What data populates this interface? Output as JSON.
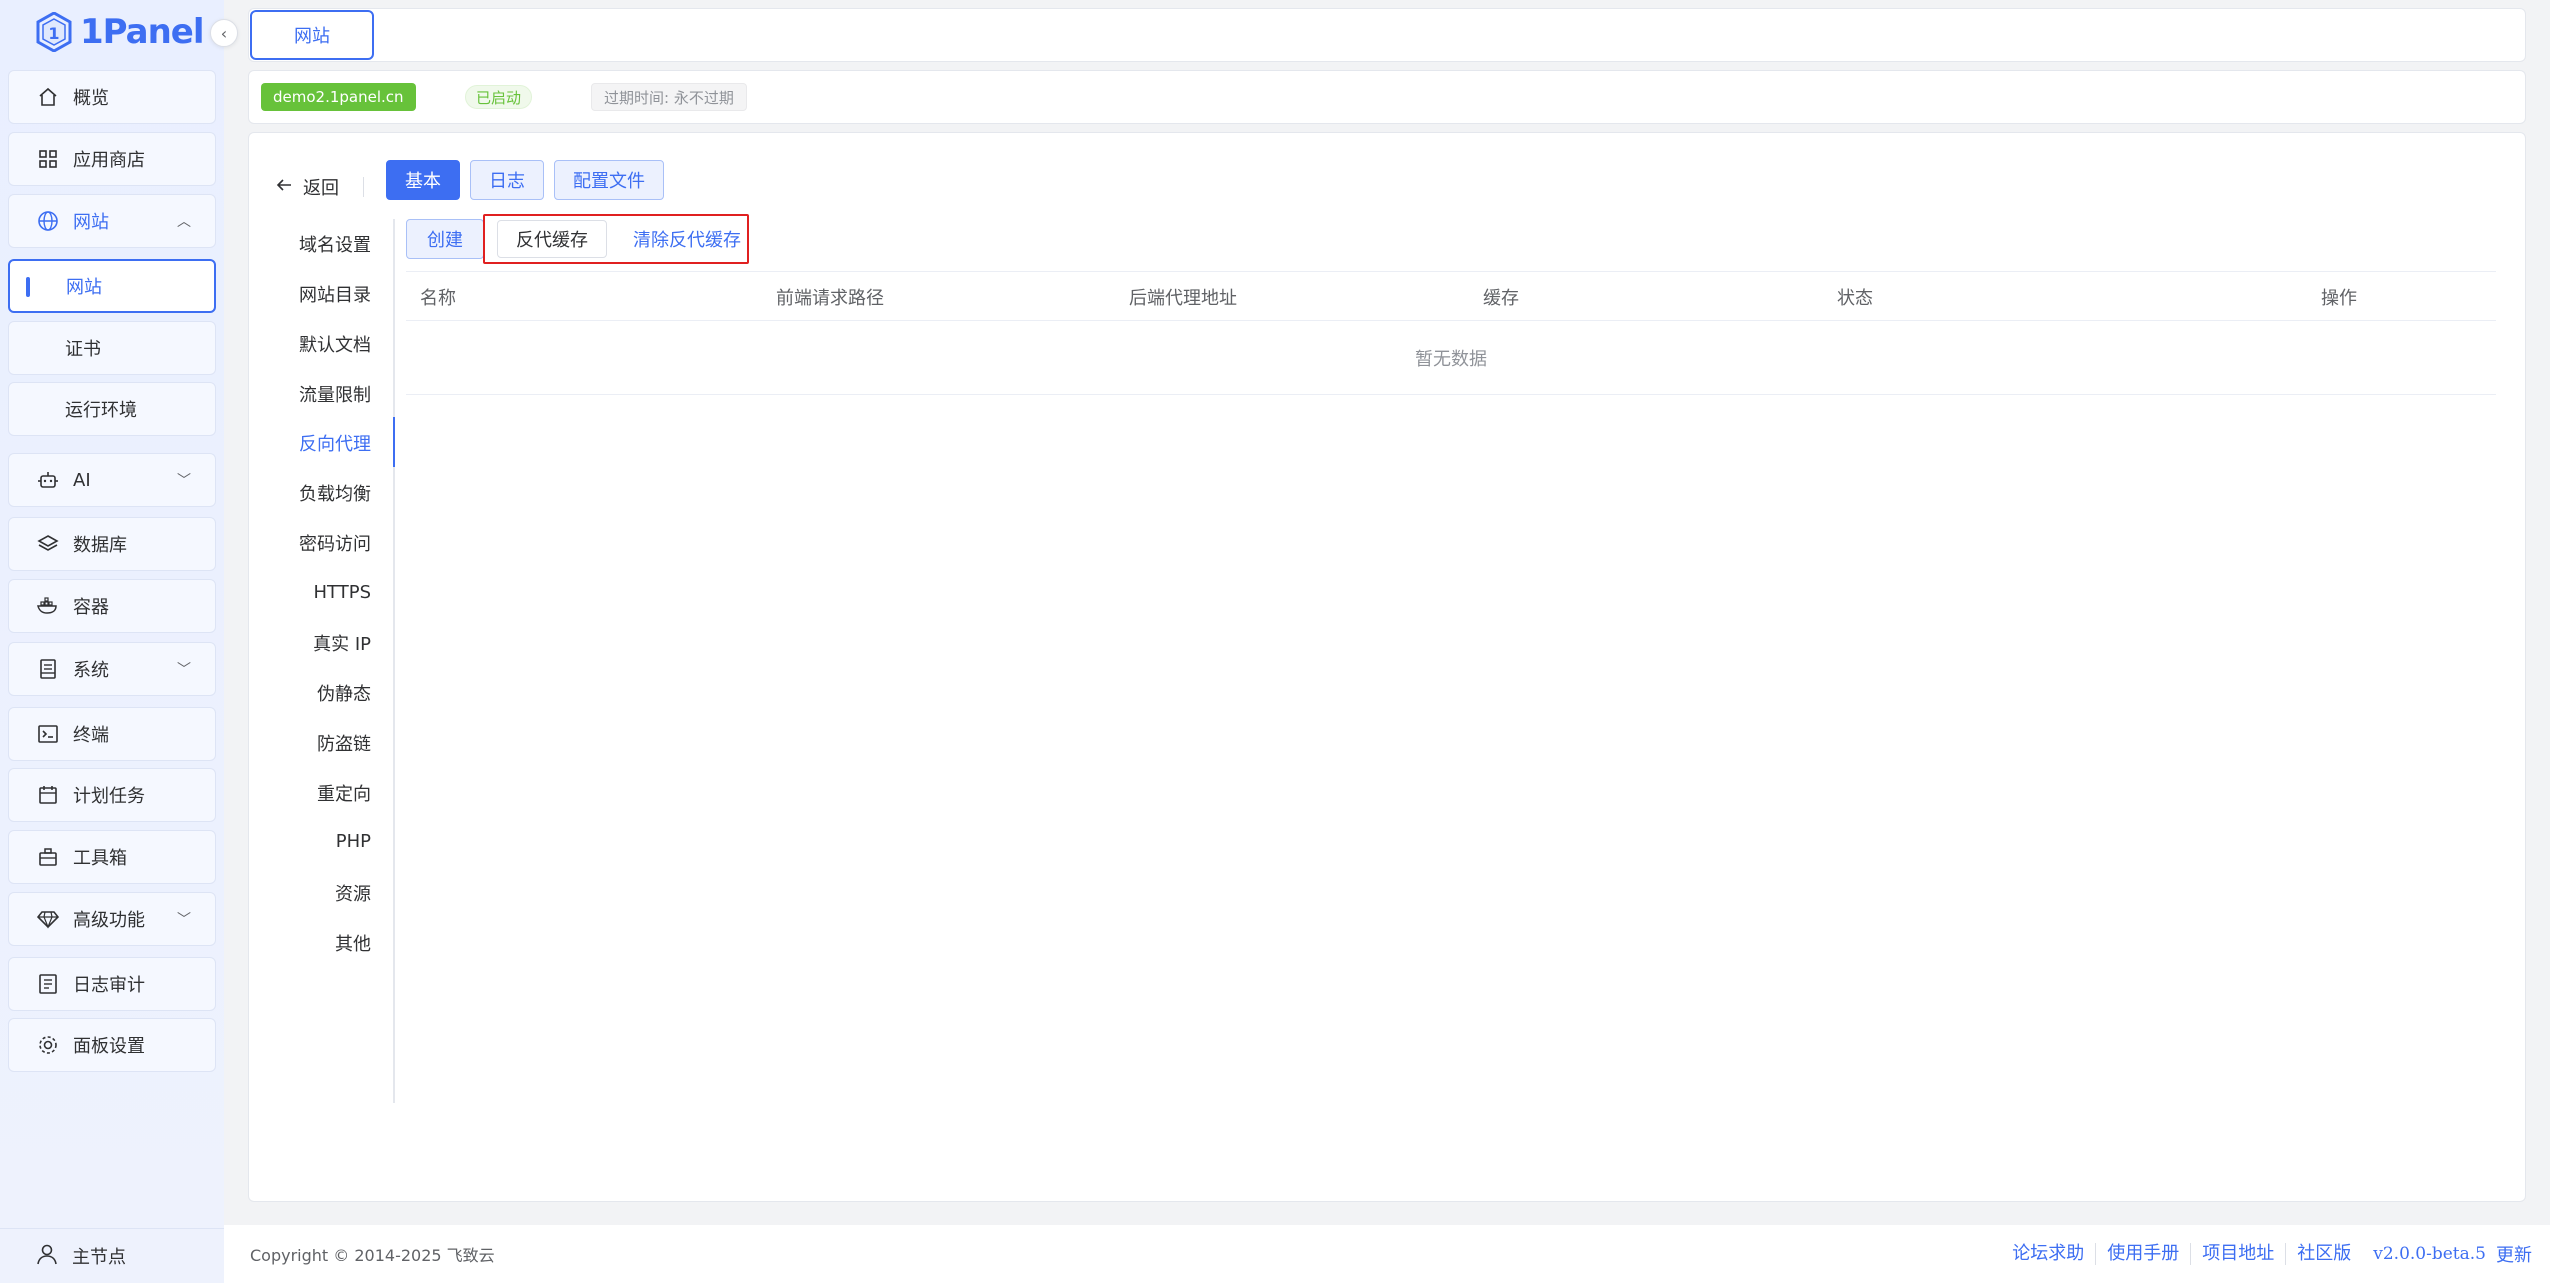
{
  "brand": {
    "name": "1Panel",
    "color": "#3d6ef2"
  },
  "sidebar": {
    "items": [
      {
        "label": "概览",
        "icon": "home-icon"
      },
      {
        "label": "应用商店",
        "icon": "grid-icon"
      },
      {
        "label": "网站",
        "icon": "globe-icon",
        "expanded": true
      },
      {
        "label": "网站",
        "sub": true,
        "active": true
      },
      {
        "label": "证书",
        "sub": true
      },
      {
        "label": "运行环境",
        "sub": true
      },
      {
        "label": "AI",
        "icon": "robot-icon"
      },
      {
        "label": "数据库",
        "icon": "layers-icon"
      },
      {
        "label": "容器",
        "icon": "docker-icon"
      },
      {
        "label": "系统",
        "icon": "server-icon"
      },
      {
        "label": "终端",
        "icon": "terminal-icon"
      },
      {
        "label": "计划任务",
        "icon": "calendar-icon"
      },
      {
        "label": "工具箱",
        "icon": "toolbox-icon"
      },
      {
        "label": "高级功能",
        "icon": "diamond-icon"
      },
      {
        "label": "日志审计",
        "icon": "log-icon"
      },
      {
        "label": "面板设置",
        "icon": "gear-icon"
      }
    ],
    "node": "主节点"
  },
  "tabs": {
    "active": "网站"
  },
  "site": {
    "domain": "demo2.1panel.cn",
    "status": "已启动",
    "expire": "过期时间: 永不过期"
  },
  "toolbar": {
    "back": "返回",
    "tab_basic": "基本",
    "tab_log": "日志",
    "tab_config": "配置文件"
  },
  "menu": {
    "items": [
      "域名设置",
      "网站目录",
      "默认文档",
      "流量限制",
      "反向代理",
      "负载均衡",
      "密码访问",
      "HTTPS",
      "真实 IP",
      "伪静态",
      "防盗链",
      "重定向",
      "PHP",
      "资源",
      "其他"
    ],
    "active": "反向代理"
  },
  "proxy": {
    "create": "创建",
    "cache": "反代缓存",
    "clear_cache": "清除反代缓存",
    "columns": [
      "名称",
      "前端请求路径",
      "后端代理地址",
      "缓存",
      "状态",
      "操作"
    ],
    "empty": "暂无数据"
  },
  "footer": {
    "copyright": "Copyright © 2014-2025 飞致云",
    "links": [
      "论坛求助",
      "使用手册",
      "项目地址",
      "社区版"
    ],
    "version": "v2.0.0-beta.5",
    "update": "更新"
  }
}
